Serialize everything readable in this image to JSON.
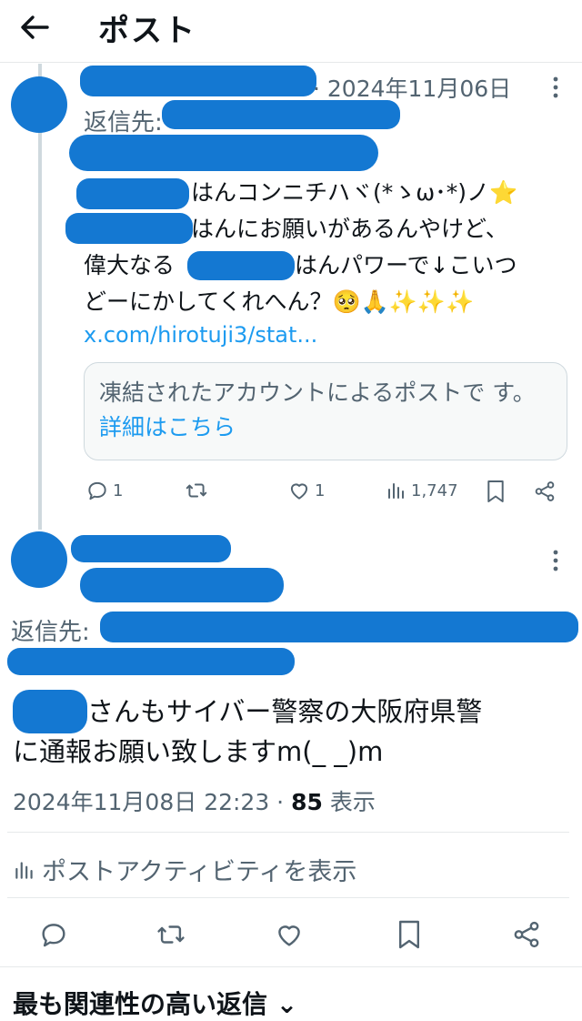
{
  "header": {
    "title": "ポスト"
  },
  "reply_post": {
    "date": "· 2024年11月06日",
    "reply_to_label": "返信先:",
    "line1": "はんコンニチハヾ(*ゝω･*)ノ⭐",
    "line2": "はんにお願いがあるんやけど、",
    "line3a": "偉大なる",
    "line3b": "はんパワーで↓こいつ",
    "line4": "どーにかしてくれへん？🥺🙏✨✨✨",
    "link": "x.com/hirotuji3/stat...",
    "card_text": "凍結されたアカウントによるポストで す。",
    "card_link": "詳細はこちら",
    "replies": "1",
    "likes": "1",
    "views": "1,747"
  },
  "main_post": {
    "reply_to_label": "返信先:",
    "text_a": "さんもサイバー警察の大阪府県警",
    "text_b": "に通報お願い致しますm(_ _)m",
    "timestamp": "2024年11月08日 22:23 · ",
    "view_count": "85",
    "view_label": " 表示",
    "activity_label": "ポストアクティビティを表示"
  },
  "sort_label": "最も関連性の高い返信 ⌄",
  "colors": {
    "scribble": "#1478d2",
    "link": "#1d9bf0",
    "muted": "#536471"
  }
}
